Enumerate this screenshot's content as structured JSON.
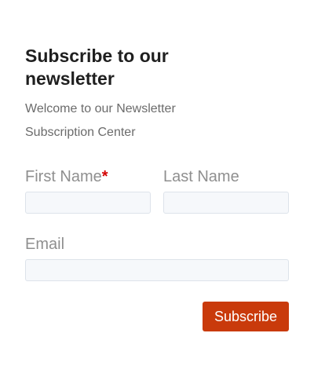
{
  "form": {
    "title": "Subscribe to our newsletter",
    "subtitle": "Welcome to our Newsletter Subscription Center",
    "fields": {
      "first_name": {
        "label": "First Name",
        "required_mark": "*",
        "value": "",
        "placeholder": ""
      },
      "last_name": {
        "label": "Last Name",
        "value": "",
        "placeholder": ""
      },
      "email": {
        "label": "Email",
        "value": "",
        "placeholder": ""
      }
    },
    "submit_label": "Subscribe"
  },
  "colors": {
    "button_bg": "#c93a0b",
    "required": "#d40000",
    "input_bg": "#f6f8fb",
    "input_border": "#dde3ea",
    "title_text": "#1f1f1f",
    "label_text": "#8f8f8f"
  }
}
